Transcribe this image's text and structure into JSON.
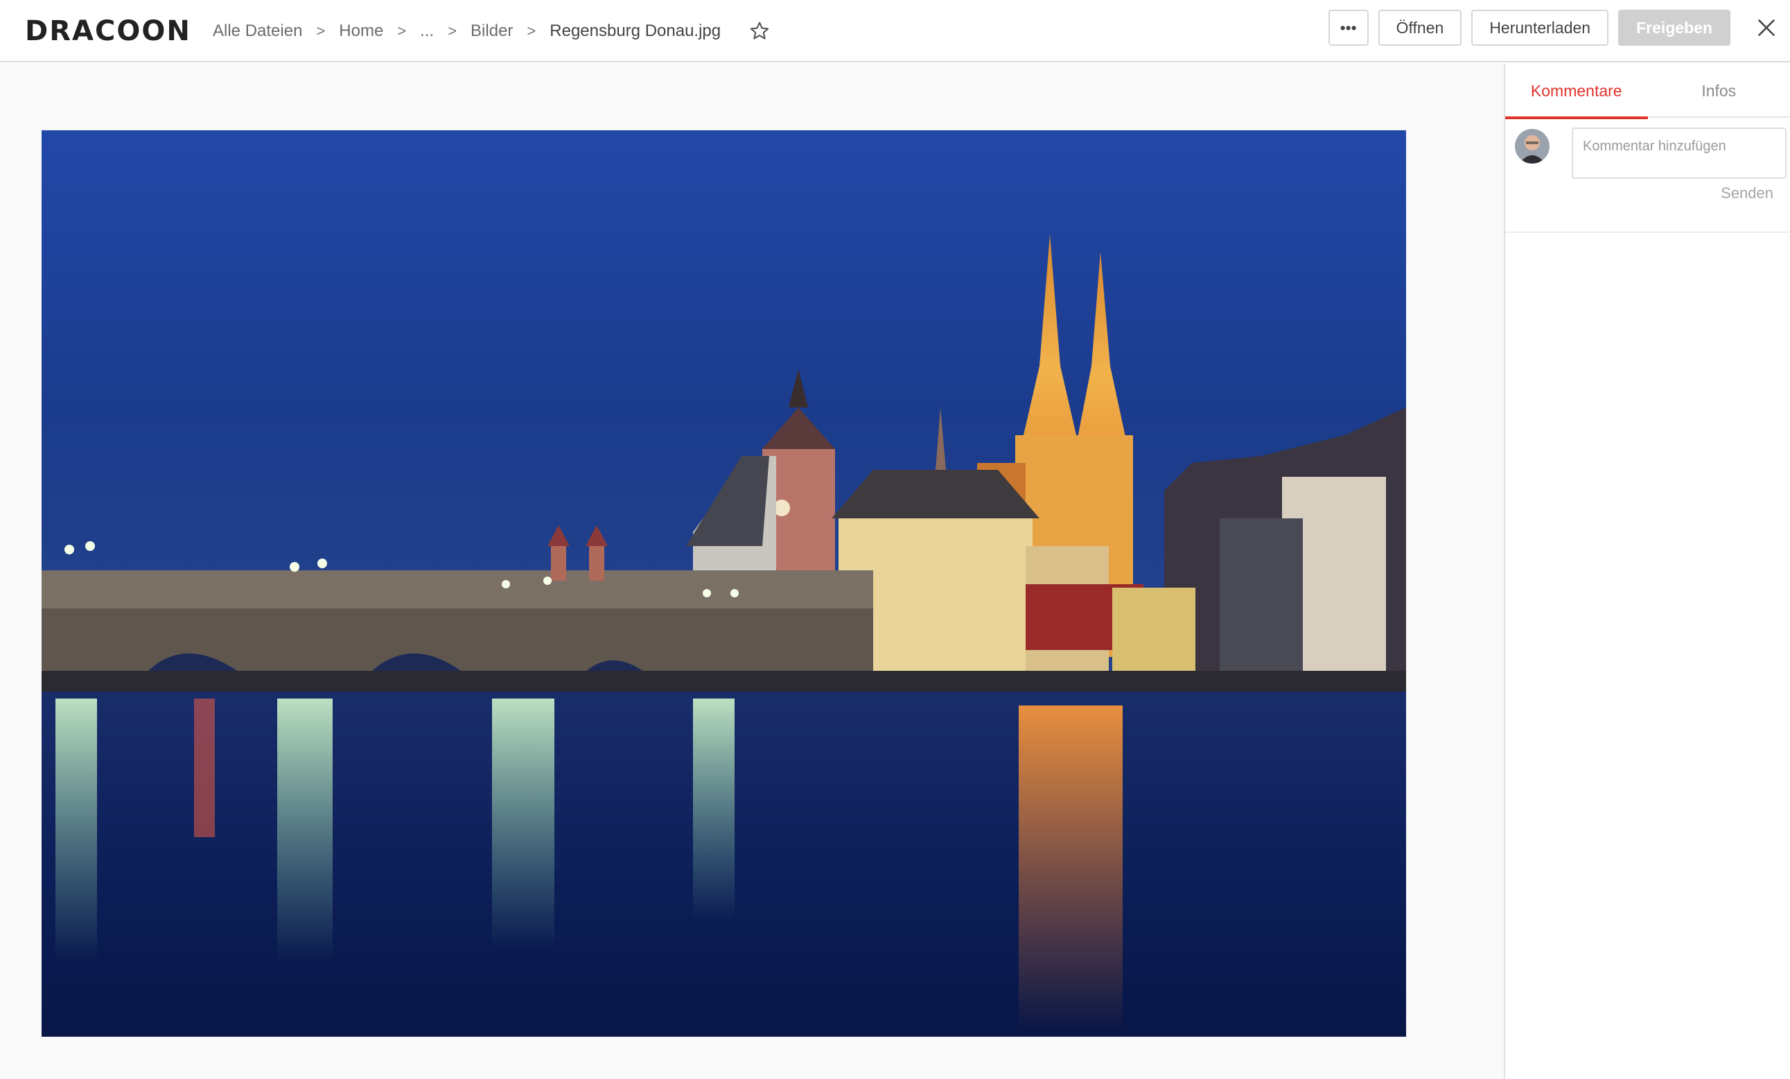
{
  "header": {
    "logo_text": "DRACOON",
    "breadcrumb": {
      "items": [
        "Alle Dateien",
        "Home",
        "...",
        "Bilder"
      ],
      "separator": ">",
      "current": "Regensburg Donau.jpg"
    },
    "favorite_icon": "star-outline-icon",
    "actions": {
      "more_label": "•••",
      "open_label": "Öffnen",
      "download_label": "Herunterladen",
      "share_label": "Freigeben",
      "close_icon": "close-icon"
    }
  },
  "viewer": {
    "image_icon": "photo-preview"
  },
  "side_panel": {
    "tabs": [
      {
        "label": "Kommentare",
        "active": true
      },
      {
        "label": "Infos",
        "active": false
      }
    ],
    "comment": {
      "placeholder": "Kommentar hinzufügen",
      "value": "",
      "send_label": "Senden"
    }
  },
  "colors": {
    "accent": "#e0332b",
    "share_disabled": "#d0d0d0",
    "sky": "#1d3f96",
    "water": "#0b1e58"
  }
}
